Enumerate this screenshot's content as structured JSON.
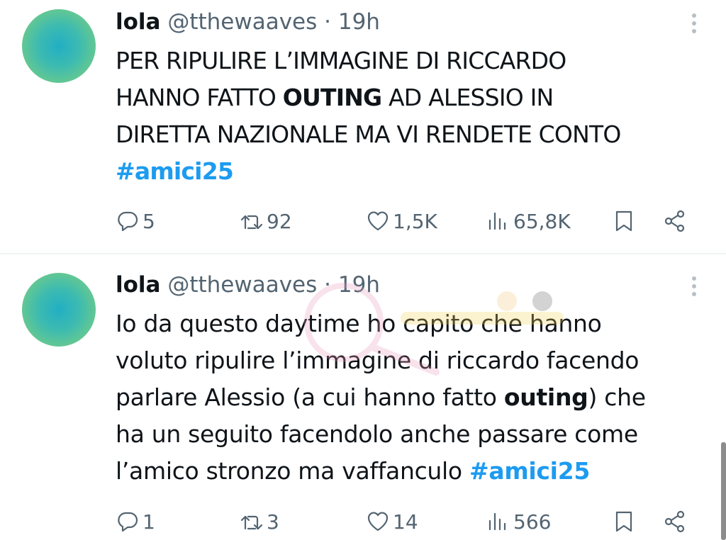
{
  "tweets": [
    {
      "name": "lola",
      "handle": "@tthewaaves",
      "separator": "·",
      "time": "19h",
      "text_lines": [
        [
          {
            "t": "PER RIPULIRE L’IMMAGINE DI RICCARDO"
          }
        ],
        [
          {
            "t": "HANNO FATTO "
          },
          {
            "t": "OUTING",
            "s": "bold"
          },
          {
            "t": " AD ALESSIO IN"
          }
        ],
        [
          {
            "t": "DIRETTA NAZIONALE MA VI RENDETE CONTO"
          }
        ],
        [
          {
            "t": "#amici25",
            "s": "hashtag"
          }
        ]
      ],
      "actions": {
        "replies": "5",
        "reposts": "92",
        "likes": "1,5K",
        "views": "65,8K"
      }
    },
    {
      "name": "lola",
      "handle": "@tthewaaves",
      "separator": "·",
      "time": "19h",
      "text_lines": [
        [
          {
            "t": "Io da questo daytime ho capito che hanno"
          }
        ],
        [
          {
            "t": "voluto ripulire l’immagine di riccardo facendo"
          }
        ],
        [
          {
            "t": "parlare Alessio (a cui hanno fatto "
          },
          {
            "t": "outing",
            "s": "bold"
          },
          {
            "t": ") che"
          }
        ],
        [
          {
            "t": "ha un seguito facendolo anche passare come"
          }
        ],
        [
          {
            "t": "l’amico stronzo ma vaffanculo  "
          },
          {
            "t": "#amici25",
            "s": "hashtag"
          }
        ]
      ],
      "actions": {
        "replies": "1",
        "reposts": "3",
        "likes": "14",
        "views": "566"
      }
    }
  ],
  "icons": {
    "reply": "reply-icon",
    "repost": "repost-icon",
    "like": "heart-icon",
    "views": "views-icon",
    "bookmark": "bookmark-icon",
    "share": "share-icon",
    "more": "more-vertical-icon"
  },
  "colors": {
    "text": "#0f1419",
    "secondary": "#536471",
    "hashtag": "#1d9bf0",
    "divider": "#eff3f4"
  }
}
